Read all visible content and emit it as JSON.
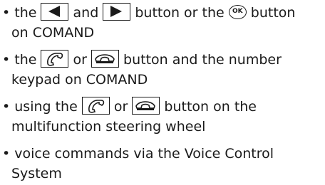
{
  "items": [
    {
      "lines": [
        [
          "• the ",
          "{left-arrow-icon}",
          " and ",
          "{right-arrow-icon}",
          " button or the ",
          "{ok-button-icon}",
          " button"
        ],
        [
          "on COMAND"
        ]
      ]
    },
    {
      "lines": [
        [
          "• the ",
          "{call-accept-icon}",
          " or ",
          "{call-end-icon}",
          " button and the number"
        ],
        [
          "keypad on COMAND"
        ]
      ]
    },
    {
      "lines": [
        [
          "• using the ",
          "{call-accept-icon}",
          " or ",
          "{call-end-icon}",
          " button on the"
        ],
        [
          "multifunction steering wheel"
        ]
      ]
    },
    {
      "lines": [
        [
          "• voice commands via the Voice Control"
        ],
        [
          "System"
        ]
      ]
    }
  ],
  "ok_label": "OK"
}
